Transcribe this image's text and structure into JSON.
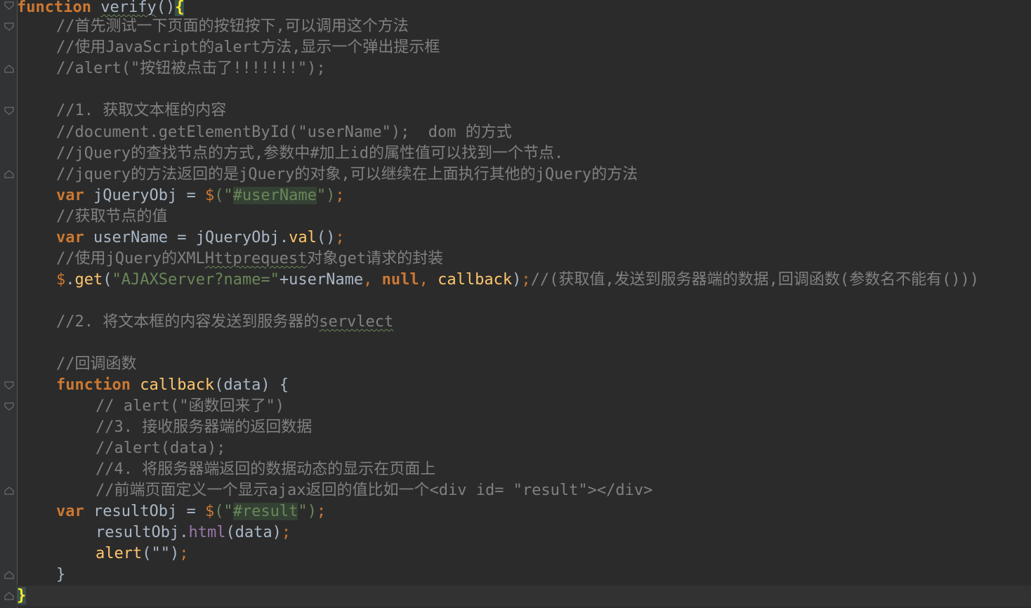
{
  "editor": {
    "theme_colors": {
      "background": "#2b2b2b",
      "gutter": "#313335",
      "keyword": "#cc7832",
      "comment": "#808080",
      "string": "#6a8759",
      "function_name": "#ffc66d",
      "identifier": "#a9b7c6"
    },
    "lines": {
      "l0": {
        "kw": "function",
        "sp": " ",
        "name": "verify",
        "paren": "()",
        "brace": "{"
      },
      "l1": {
        "comment": "//首先测试一下页面的按钮按下,可以调用这个方法"
      },
      "l2": {
        "comment": "//使用JavaScript的alert方法,显示一个弹出提示框"
      },
      "l3": {
        "comment": "//alert(\"按钮被点击了!!!!!!!\");"
      },
      "l5": {
        "comment": "//1. 获取文本框的内容"
      },
      "l6": {
        "comment": "//document.getElementById(\"userName\");  dom 的方式"
      },
      "l7": {
        "comment": "//jQuery的查找节点的方式,参数中#加上id的属性值可以找到一个节点."
      },
      "l8": {
        "comment": "//jquery的方法返回的是jQuery的对象,可以继续在上面执行其他的jQuery的方法"
      },
      "l9": {
        "kw": "var",
        "ident": " jQueryObj = ",
        "dollar": "$",
        "open": "(\"",
        "str": "#userName",
        "close": "\")",
        "semi": ";"
      },
      "l10": {
        "comment": "//获取节点的值"
      },
      "l11": {
        "kw": "var",
        "ident": " userName = jQueryObj.",
        "method": "val",
        "call": "()",
        "semi": ";"
      },
      "l12": {
        "comment_a": "//使用jQuery的XML",
        "comment_b": "Httprequest",
        "comment_c": "对象get请求的封装"
      },
      "l13": {
        "dollar": "$",
        "dot": ".",
        "method": "get",
        "open": "(",
        "str": "\"AJAXServer?name=\"",
        "plus": "+userName",
        "comma1": ", ",
        "null": "null",
        "comma2": ", ",
        "cb": "callback",
        "close": ")",
        "semi": ";",
        "comment": "//(获取值,发送到服务器端的数据,回调函数(参数名不能有()))"
      },
      "l15": {
        "comment_a": "//2. 将文本框的内容发送到服务器的",
        "comment_b": "servlect"
      },
      "l17": {
        "comment": "//回调函数"
      },
      "l18": {
        "kw": "function",
        "sp": " ",
        "name": "callback",
        "rest": "(data) {"
      },
      "l19": {
        "comment": "// alert(\"函数回来了\")"
      },
      "l20": {
        "comment": "//3. 接收服务器端的返回数据"
      },
      "l21": {
        "comment": "//alert(data);"
      },
      "l22": {
        "comment": "//4. 将服务器端返回的数据动态的显示在页面上"
      },
      "l23": {
        "comment": "//前端页面定义一个显示ajax返回的值比如一个<div id= \"result\"></div>"
      },
      "l24": {
        "kw": "var",
        "ident": " resultObj = ",
        "dollar": "$",
        "open": "(\"",
        "str": "#result",
        "close": "\")",
        "semi": ";"
      },
      "l25": {
        "ident": "resultObj.",
        "method": "html",
        "rest": "(data)",
        "semi": ";"
      },
      "l26": {
        "method": "alert",
        "rest": "(\"\")",
        "semi": ";"
      },
      "l27": {
        "brace": "}"
      },
      "l28": {
        "brace": "}"
      }
    }
  }
}
